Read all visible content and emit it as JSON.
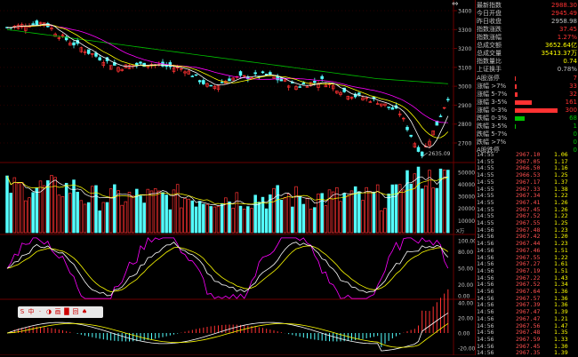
{
  "colors": {
    "up": "#ff3232",
    "down": "#54ffff",
    "ma5": "#ffffff",
    "ma10": "#ffff00",
    "ma20": "#ff00ff",
    "ma60": "#00c000",
    "grid": "#6a0000"
  },
  "main_axis": {
    "ticks": [
      "3400",
      "3300",
      "3200",
      "3100",
      "3000",
      "2900",
      "2800",
      "2700"
    ],
    "min_label": "2635.09"
  },
  "vol_axis": {
    "ticks": [
      "50000",
      "40000",
      "30000",
      "20000",
      "10000"
    ],
    "unit": "X万"
  },
  "kdj_axis": {
    "ticks": [
      "100.00",
      "80.00",
      "50.00",
      "20.00",
      "0.00"
    ]
  },
  "macd_axis": {
    "ticks": [
      "40.00",
      "20.00",
      "0.00",
      "-20.00"
    ]
  },
  "stats": [
    {
      "label": "最新指数",
      "value": "2988.30",
      "color": "#ff3232"
    },
    {
      "label": "今日开盘",
      "value": "2945.49",
      "color": "#ff3232"
    },
    {
      "label": "昨日收盘",
      "value": "2958.98",
      "color": "#c0c0c0"
    },
    {
      "label": "指数涨跌",
      "value": "37.45",
      "color": "#ff3232"
    },
    {
      "label": "指数涨幅",
      "value": "1.27%",
      "color": "#ff3232"
    },
    {
      "label": "总成交额",
      "value": "3652.64亿",
      "color": "#ffff00"
    },
    {
      "label": "总成交量",
      "value": "35413.37万",
      "color": "#ffff00"
    },
    {
      "label": "指数量比",
      "value": "0.74",
      "color": "#ffff00"
    },
    {
      "label": "上证换手",
      "value": "0.78%",
      "color": "#c0c0c0"
    }
  ],
  "distribution": [
    {
      "label": "A股涨停",
      "value": "7",
      "bar": 0.03,
      "color": "#ff3232"
    },
    {
      "label": "涨幅 >7%",
      "value": "33",
      "bar": 0.05,
      "color": "#ff3232"
    },
    {
      "label": "涨幅 5-7%",
      "value": "32",
      "bar": 0.06,
      "color": "#ff3232"
    },
    {
      "label": "涨幅 3-5%",
      "value": "161",
      "bar": 0.4,
      "color": "#ff3232"
    },
    {
      "label": "涨幅 0-3%",
      "value": "300",
      "bar": 1.0,
      "color": "#ff3232"
    },
    {
      "label": "跌幅 0-3%",
      "value": "68",
      "bar": 0.22,
      "color": "#00c000"
    },
    {
      "label": "跌幅 3-5%",
      "value": "1",
      "bar": 0.01,
      "color": "#00c000"
    },
    {
      "label": "跌幅 5-7%",
      "value": "0",
      "bar": 0,
      "color": "#00c000"
    },
    {
      "label": "跌幅 >7%",
      "value": "0",
      "bar": 0,
      "color": "#00c000"
    },
    {
      "label": "A股跌停",
      "value": "0",
      "bar": 0,
      "color": "#00c000"
    }
  ],
  "ticks": [
    [
      "14:55",
      "2967.10",
      "1.06"
    ],
    [
      "14:55",
      "2967.05",
      "1.17"
    ],
    [
      "14:55",
      "2966.50",
      "1.16"
    ],
    [
      "14:55",
      "2966.53",
      "1.25"
    ],
    [
      "14:55",
      "2967.17",
      "1.37"
    ],
    [
      "14:55",
      "2967.33",
      "1.38"
    ],
    [
      "14:55",
      "2967.34",
      "1.22"
    ],
    [
      "14:55",
      "2967.41",
      "1.26"
    ],
    [
      "14:55",
      "2967.45",
      "1.26"
    ],
    [
      "14:55",
      "2967.52",
      "1.22"
    ],
    [
      "14:55",
      "2967.55",
      "1.25"
    ],
    [
      "14:56",
      "2967.48",
      "1.23"
    ],
    [
      "14:56",
      "2967.42",
      "1.20"
    ],
    [
      "14:56",
      "2967.44",
      "1.23"
    ],
    [
      "14:56",
      "2967.46",
      "1.51"
    ],
    [
      "14:56",
      "2967.55",
      "1.22"
    ],
    [
      "14:56",
      "2967.27",
      "1.61"
    ],
    [
      "14:56",
      "2967.19",
      "1.51"
    ],
    [
      "14:56",
      "2967.22",
      "1.43"
    ],
    [
      "14:56",
      "2967.52",
      "1.34"
    ],
    [
      "14:56",
      "2967.64",
      "1.36"
    ],
    [
      "14:56",
      "2967.57",
      "1.36"
    ],
    [
      "14:56",
      "2967.39",
      "1.36"
    ],
    [
      "14:56",
      "2967.47",
      "1.39"
    ],
    [
      "14:56",
      "2967.47",
      "1.21"
    ],
    [
      "14:56",
      "2967.56",
      "1.47"
    ],
    [
      "14:56",
      "2967.48",
      "1.35"
    ],
    [
      "14:56",
      "2967.59",
      "1.33"
    ],
    [
      "14:56",
      "2967.45",
      "1.30"
    ],
    [
      "14:56",
      "2967.35",
      "1.39"
    ]
  ],
  "toolbar": [
    "S",
    "中",
    "·",
    "◑",
    "画",
    "█",
    "回",
    "♠"
  ],
  "top_arrow": "⇔"
}
